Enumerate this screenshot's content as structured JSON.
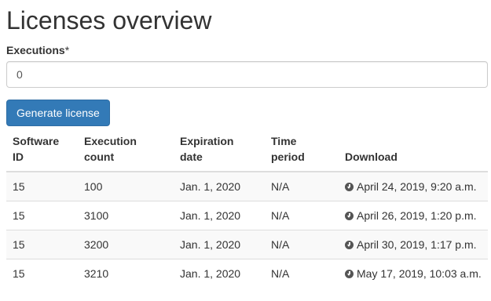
{
  "page": {
    "title": "Licenses overview"
  },
  "form": {
    "executions_label": "Executions",
    "required_marker": "*",
    "executions_value": "0",
    "generate_button_label": "Generate license"
  },
  "table": {
    "headers": {
      "software_id": "Software ID",
      "execution_count": "Execution count",
      "expiration_date": "Expiration date",
      "time_period": "Time period",
      "download": "Download"
    },
    "rows": [
      {
        "software_id": "15",
        "execution_count": "100",
        "expiration_date": "Jan. 1, 2020",
        "time_period": "N/A",
        "download": "April 24, 2019, 9:20 a.m."
      },
      {
        "software_id": "15",
        "execution_count": "3100",
        "expiration_date": "Jan. 1, 2020",
        "time_period": "N/A",
        "download": "April 26, 2019, 1:20 p.m."
      },
      {
        "software_id": "15",
        "execution_count": "3200",
        "expiration_date": "Jan. 1, 2020",
        "time_period": "N/A",
        "download": "April 30, 2019, 1:17 p.m."
      },
      {
        "software_id": "15",
        "execution_count": "3210",
        "expiration_date": "Jan. 1, 2020",
        "time_period": "N/A",
        "download": "May 17, 2019, 10:03 a.m."
      }
    ]
  },
  "icons": {
    "download": "download-circle-icon"
  },
  "colors": {
    "primary_button": "#337ab7",
    "text": "#333333",
    "row_stripe": "#f9f9f9",
    "border": "#dddddd"
  }
}
